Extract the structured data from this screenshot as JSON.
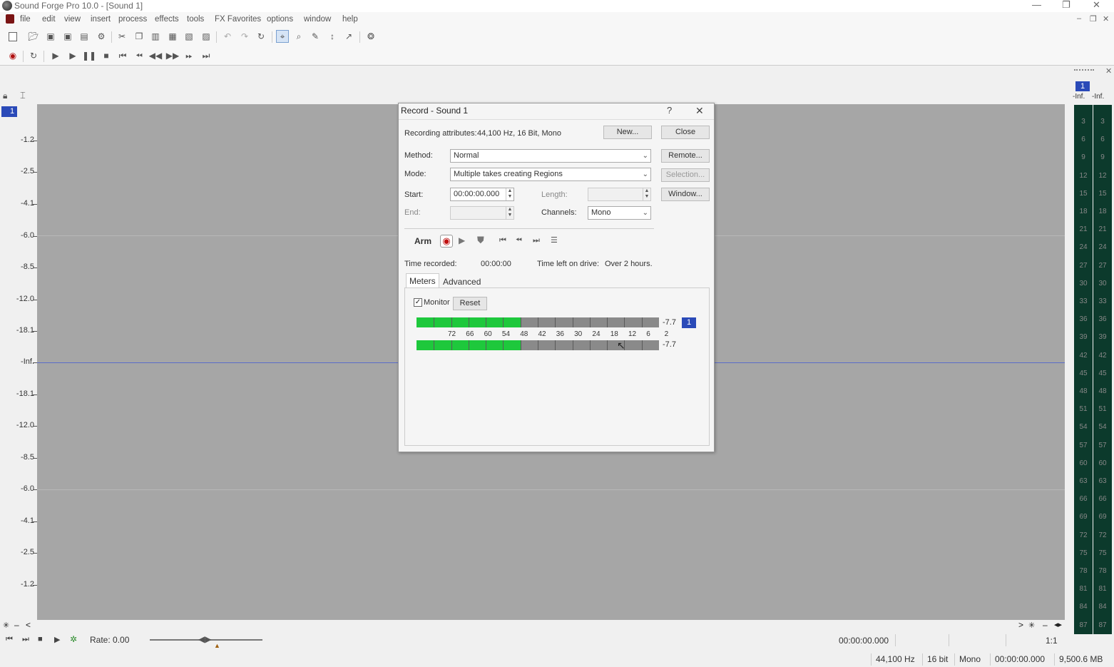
{
  "app": {
    "title": "Sound Forge Pro 10.0 - [Sound 1]",
    "window_controls": {
      "minimize": "—",
      "restore": "❐",
      "close": "✕"
    }
  },
  "menubar": {
    "items": [
      "file",
      "edit",
      "view",
      "insert",
      "process",
      "effects",
      "tools",
      "FX Favorites",
      "options",
      "window",
      "help"
    ]
  },
  "toolbar1": {
    "icons": [
      "new-icon",
      "open-icon",
      "save-icon",
      "save-as-icon",
      "render-icon",
      "properties-icon",
      "cut-icon",
      "copy-icon",
      "paste-icon",
      "paste-special-icon",
      "mix-icon",
      "trim-icon",
      "undo-icon",
      "redo-icon",
      "repeat-icon",
      "edit-tool-icon",
      "magnify-tool-icon",
      "pencil-tool-icon",
      "envelope-tool-icon",
      "event-tool-icon",
      "snap-icon"
    ]
  },
  "toolbar2": {
    "icons": [
      "record-icon",
      "loop-icon",
      "play-all-icon",
      "play-icon",
      "pause-icon",
      "stop-icon",
      "go-to-start-icon",
      "previous-icon",
      "rewind-icon",
      "fast-forward-icon",
      "next-icon",
      "go-to-end-icon"
    ]
  },
  "track": {
    "number": "1",
    "db_labels": [
      "-1.2",
      "-2.5",
      "-4.1",
      "-6.0",
      "-8.5",
      "-12.0",
      "-18.1",
      "-Inf.",
      "-18.1",
      "-12.0",
      "-8.5",
      "-6.0",
      "-4.1",
      "-2.5",
      "-1.2"
    ]
  },
  "transport": {
    "rate_label": "Rate: 0.00",
    "time": "00:00:00.000",
    "zoom": "1:1"
  },
  "statusbar": {
    "sample_rate": "44,100 Hz",
    "bit_depth": "16 bit",
    "channels": "Mono",
    "length": "00:00:00.000",
    "disk": "9,500.6 MB"
  },
  "meters": {
    "channel": "1",
    "peaks": [
      "-Inf.",
      "-Inf."
    ],
    "scale": [
      "3",
      "6",
      "9",
      "12",
      "15",
      "18",
      "21",
      "24",
      "27",
      "30",
      "33",
      "36",
      "39",
      "42",
      "45",
      "48",
      "51",
      "54",
      "57",
      "60",
      "63",
      "66",
      "69",
      "72",
      "75",
      "78",
      "81",
      "84",
      "87"
    ]
  },
  "dialog": {
    "title": "Record - Sound 1",
    "help": "?",
    "close_x": "✕",
    "recording_attributes_label": "Recording attributes:",
    "recording_attributes_value": "44,100 Hz, 16 Bit, Mono",
    "buttons": {
      "new": "New...",
      "close": "Close",
      "remote": "Remote...",
      "selection": "Selection...",
      "window": "Window..."
    },
    "method_label": "Method:",
    "method_value": "Normal",
    "mode_label": "Mode:",
    "mode_value": "Multiple takes creating Regions",
    "start_label": "Start:",
    "start_value": "00:00:00.000",
    "end_label": "End:",
    "end_value": "",
    "length_label": "Length:",
    "length_value": "",
    "channels_label": "Channels:",
    "channels_value": "Mono",
    "arm_label": "Arm",
    "time_recorded_label": "Time recorded:",
    "time_recorded_value": "00:00:00",
    "time_left_label": "Time left on drive:",
    "time_left_value": "Over 2 hours.",
    "tabs": [
      "Meters",
      "Advanced"
    ],
    "monitor_label": "Monitor",
    "monitor_checked": true,
    "reset_label": "Reset",
    "level_value": "-7.7",
    "level_value_2": "-7.7",
    "level_fraction": 0.43,
    "level_channel": "1",
    "scale_ticks": [
      "72",
      "66",
      "60",
      "54",
      "48",
      "42",
      "36",
      "30",
      "24",
      "18",
      "12",
      "6",
      "2"
    ]
  }
}
